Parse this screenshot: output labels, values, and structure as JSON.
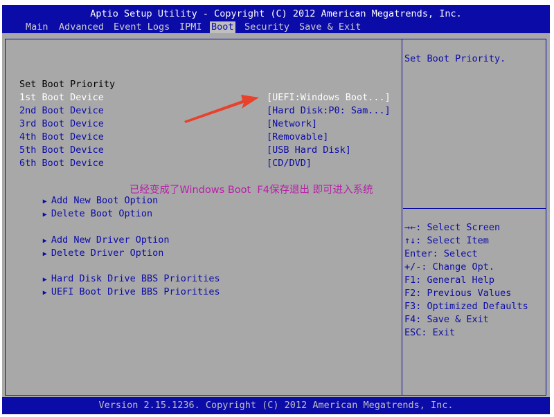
{
  "header": {
    "title": "Aptio Setup Utility - Copyright (C) 2012 American Megatrends, Inc.",
    "tabs": [
      {
        "label": "Main"
      },
      {
        "label": "Advanced"
      },
      {
        "label": "Event Logs"
      },
      {
        "label": "IPMI"
      },
      {
        "label": "Boot"
      },
      {
        "label": "Security"
      },
      {
        "label": "Save & Exit"
      }
    ],
    "active_tab": "Boot"
  },
  "main": {
    "section_title": "Set Boot Priority",
    "boot_devices": [
      {
        "label": "1st Boot Device",
        "value": "[UEFI:Windows Boot...]"
      },
      {
        "label": "2nd Boot Device",
        "value": "[Hard Disk:P0: Sam...]"
      },
      {
        "label": "3rd Boot Device",
        "value": "[Network]"
      },
      {
        "label": "4th Boot Device",
        "value": "[Removable]"
      },
      {
        "label": "5th Boot Device",
        "value": "[USB Hard Disk]"
      },
      {
        "label": "6th Boot Device",
        "value": "[CD/DVD]"
      }
    ],
    "submenus": [
      {
        "label": "Add New Boot Option"
      },
      {
        "label": "Delete Boot Option"
      },
      {
        "label": "Add New Driver Option"
      },
      {
        "label": "Delete Driver Option"
      },
      {
        "label": "Hard Disk Drive BBS Priorities"
      },
      {
        "label": "UEFI Boot Drive BBS Priorities"
      }
    ],
    "annotation": "已经变成了Windows Boot  F4保存退出 即可进入系统"
  },
  "help": {
    "text": "Set Boot Priority.",
    "keys": [
      "→←: Select Screen",
      "↑↓: Select Item",
      "Enter: Select",
      "+/-: Change Opt.",
      "F1: General Help",
      "F2: Previous Values",
      "F3: Optimized Defaults",
      "F4: Save & Exit",
      "ESC: Exit"
    ]
  },
  "footer": {
    "text": "Version 2.15.1236. Copyright (C) 2012 American Megatrends, Inc."
  },
  "colors": {
    "bios_blue": "#0b0ba8",
    "background_gray": "#a8a8a8",
    "annotation_magenta": "#b81fa8",
    "arrow_red": "#e8412c"
  }
}
